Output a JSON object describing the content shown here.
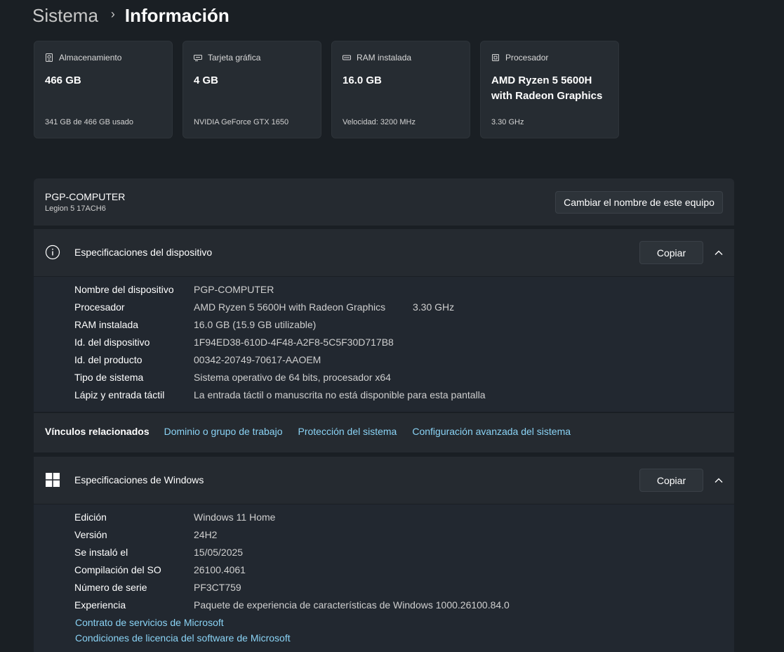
{
  "breadcrumb": {
    "parent": "Sistema",
    "current": "Información"
  },
  "cards": [
    {
      "icon": "storage-icon",
      "title": "Almacenamiento",
      "value": "466 GB",
      "sub": "341 GB de 466 GB usado"
    },
    {
      "icon": "gpu-icon",
      "title": "Tarjeta gráfica",
      "value": "4 GB",
      "sub": "NVIDIA GeForce GTX 1650"
    },
    {
      "icon": "ram-icon",
      "title": "RAM instalada",
      "value": "16.0 GB",
      "sub": "Velocidad: 3200 MHz"
    },
    {
      "icon": "cpu-icon",
      "title": "Procesador",
      "value": "AMD Ryzen 5 5600H with Radeon Graphics",
      "sub": "3.30 GHz"
    }
  ],
  "device": {
    "name": "PGP-COMPUTER",
    "model": "Legion 5 17ACH6",
    "rename_label": "Cambiar el nombre de este equipo"
  },
  "device_specs": {
    "title": "Especificaciones del dispositivo",
    "copy_label": "Copiar",
    "rows": [
      {
        "label": "Nombre del dispositivo",
        "value": "PGP-COMPUTER"
      },
      {
        "label": "Procesador",
        "value": "AMD Ryzen 5 5600H with Radeon Graphics",
        "extra": "3.30 GHz"
      },
      {
        "label": "RAM instalada",
        "value": "16.0 GB (15.9 GB utilizable)"
      },
      {
        "label": "Id. del dispositivo",
        "value": "1F94ED38-610D-4F48-A2F8-5C5F30D717B8"
      },
      {
        "label": "Id. del producto",
        "value": "00342-20749-70617-AAOEM"
      },
      {
        "label": "Tipo de sistema",
        "value": "Sistema operativo de 64 bits, procesador x64"
      },
      {
        "label": "Lápiz y entrada táctil",
        "value": "La entrada táctil o manuscrita no está disponible para esta pantalla"
      }
    ]
  },
  "related_links": {
    "title": "Vínculos relacionados",
    "links": [
      "Dominio o grupo de trabajo",
      "Protección del sistema",
      "Configuración avanzada del sistema"
    ]
  },
  "windows_specs": {
    "title": "Especificaciones de Windows",
    "copy_label": "Copiar",
    "rows": [
      {
        "label": "Edición",
        "value": "Windows 11 Home"
      },
      {
        "label": "Versión",
        "value": "24H2"
      },
      {
        "label": "Se instaló el",
        "value": "15/05/2025"
      },
      {
        "label": "Compilación del SO",
        "value": "26100.4061"
      },
      {
        "label": "Número de serie",
        "value": "PF3CT759"
      },
      {
        "label": "Experiencia",
        "value": "Paquete de experiencia de características de Windows 1000.26100.84.0"
      }
    ],
    "links": [
      "Contrato de servicios de Microsoft",
      "Condiciones de licencia del software de Microsoft"
    ]
  },
  "colors": {
    "background": "#1a1f24",
    "panel": "#252a30",
    "link": "#8ad3f5"
  }
}
